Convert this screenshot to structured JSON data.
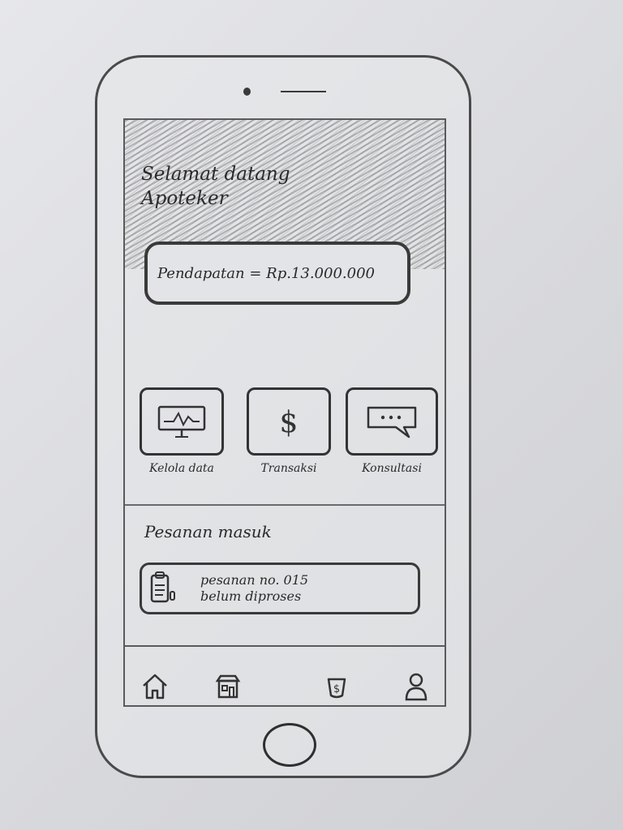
{
  "header": {
    "greeting_line1": "Selamat datang",
    "greeting_line2": "Apoteker",
    "income_text": "Pendapatan = Rp.13.000.000"
  },
  "menu": {
    "items": [
      {
        "label": "Kelola data",
        "icon": "monitor-chart-icon"
      },
      {
        "label": "Transaksi",
        "icon": "dollar-icon"
      },
      {
        "label": "Konsultasi",
        "icon": "chat-bubble-icon"
      }
    ]
  },
  "orders": {
    "title": "Pesanan masuk",
    "items": [
      {
        "line1": "pesanan no. 015",
        "line2": "belum diproses",
        "icon": "clipboard-icon"
      }
    ]
  },
  "bottom_nav": {
    "items": [
      {
        "icon": "home-icon"
      },
      {
        "icon": "store-icon"
      },
      {
        "icon": "money-bag-icon"
      },
      {
        "icon": "user-icon"
      }
    ]
  }
}
